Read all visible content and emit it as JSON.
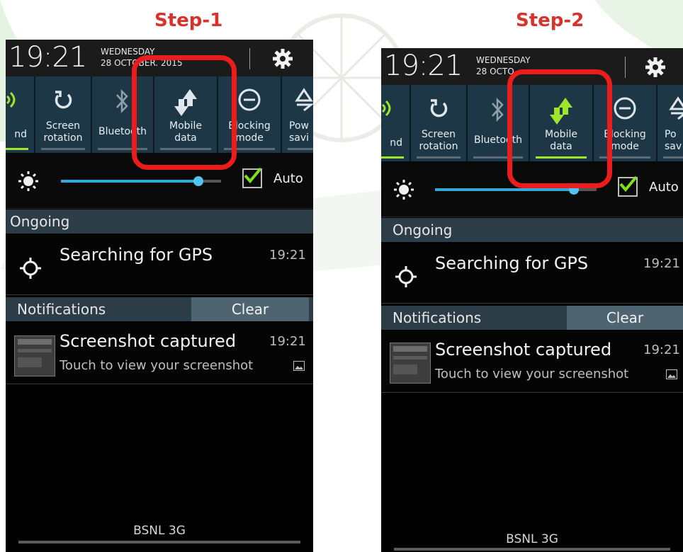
{
  "steps": [
    "Step-1",
    "Step-2"
  ],
  "status": {
    "time": "19:21",
    "day": "WEDNESDAY",
    "date": "28 OCTOBER. 2015",
    "date_visible_1": "28 OCTOBER. 2015",
    "date_visible_2": "28 OCTO"
  },
  "quick_settings": [
    {
      "label": "nd",
      "icon": "sound-icon"
    },
    {
      "label": "Screen\nrotation",
      "icon": "rotation-icon"
    },
    {
      "label": "Bluetooth",
      "icon": "bluetooth-icon"
    },
    {
      "label": "Mobile\ndata",
      "icon": "mobile-data-icon"
    },
    {
      "label": "Blocking\nmode",
      "icon": "blocking-icon"
    },
    {
      "label": "Pow\nsavi",
      "icon": "power-saving-icon"
    }
  ],
  "quick_labels_step2": [
    "nd",
    "Screen\nrotation",
    "Bluetooth",
    "Mobile\ndata",
    "Blocking\nmode",
    "Po\nsav"
  ],
  "mobile_data_state": {
    "step1": "off",
    "step2": "on"
  },
  "brightness": {
    "level": 0.86,
    "auto_checked": true,
    "auto_label": "Auto"
  },
  "ongoing": {
    "header": "Ongoing",
    "title": "Searching for GPS",
    "time": "19:21"
  },
  "notifications": {
    "header": "Notifications",
    "clear_label": "Clear",
    "item": {
      "title": "Screenshot captured",
      "subtitle": "Touch to view your screenshot",
      "time": "19:21"
    }
  },
  "carrier": "BSNL 3G",
  "colors": {
    "highlight": "#ea1c1c",
    "step_title": "#d8322a",
    "active": "#9ee62b",
    "accent": "#35a9d8"
  }
}
